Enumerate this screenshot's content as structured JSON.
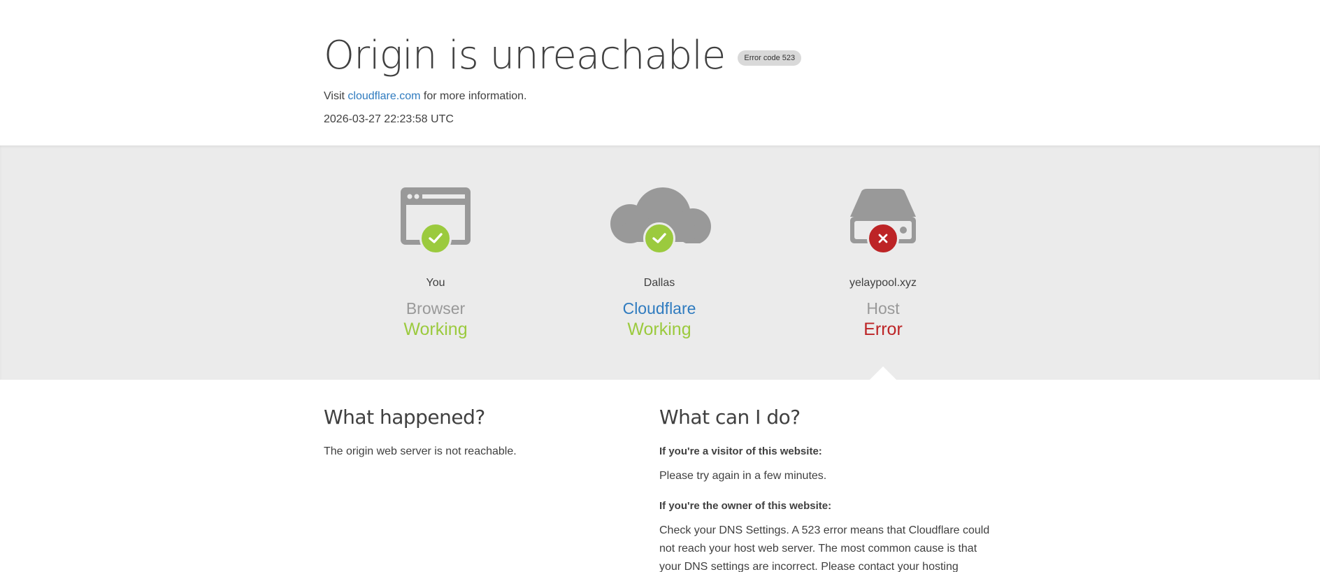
{
  "header": {
    "title": "Origin is unreachable",
    "error_badge": "Error code 523",
    "visit_prefix": "Visit",
    "visit_link": "cloudflare.com",
    "visit_suffix": "for more information.",
    "timestamp": "2026-03-27 22:23:58 UTC"
  },
  "status": {
    "browser": {
      "location": "You",
      "role": "Browser",
      "state": "Working",
      "icon": "browser-icon",
      "status": "ok"
    },
    "cloudflare": {
      "location": "Dallas",
      "role": "Cloudflare",
      "state": "Working",
      "icon": "cloud-icon",
      "status": "ok"
    },
    "host": {
      "location": "yelaypool.xyz",
      "role": "Host",
      "state": "Error",
      "icon": "server-icon",
      "status": "error"
    }
  },
  "colors": {
    "ok": "#9bca3e",
    "error": "#bd2426",
    "link": "#2f7bbf",
    "icon_gray": "#999999",
    "band": "#ebebeb"
  },
  "what_happened": {
    "heading": "What happened?",
    "body": "The origin web server is not reachable."
  },
  "what_can_i_do": {
    "heading": "What can I do?",
    "visitor_heading": "If you're a visitor of this website:",
    "visitor_body": "Please try again in a few minutes.",
    "owner_heading": "If you're the owner of this website:",
    "owner_body": "Check your DNS Settings. A 523 error means that Cloudflare could not reach your host web server. The most common cause is that your DNS settings are incorrect. Please contact your hosting"
  }
}
